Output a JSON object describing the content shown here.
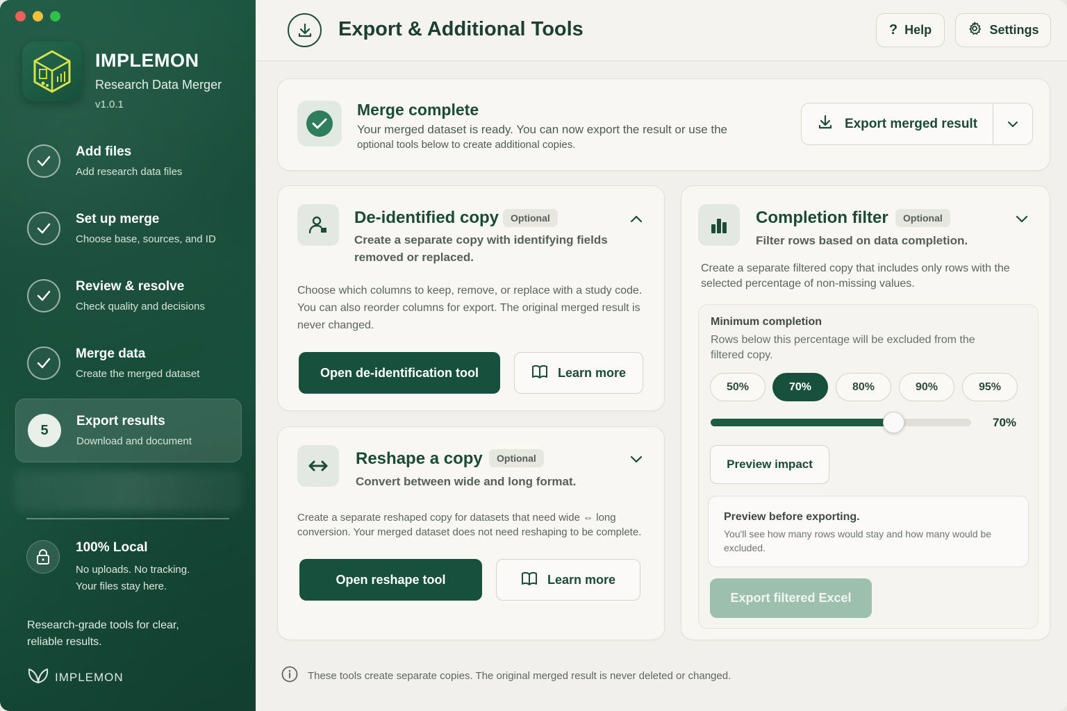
{
  "app": {
    "name": "IMPLEMON",
    "subtitle": "Research Data Merger",
    "version": "v1.0.1"
  },
  "sidebar": {
    "steps": [
      {
        "title": "Add files",
        "subtitle": "Add research data files",
        "state": "done"
      },
      {
        "title": "Set up merge",
        "subtitle": "Choose base, sources, and ID",
        "state": "done"
      },
      {
        "title": "Review & resolve",
        "subtitle": "Check quality and decisions",
        "state": "done"
      },
      {
        "title": "Merge data",
        "subtitle": "Create the merged dataset",
        "state": "done"
      },
      {
        "title": "Export results",
        "subtitle": "Download and document",
        "state": "active",
        "number": "5"
      }
    ],
    "local": {
      "title": "100% Local",
      "subtitle": "No uploads. No tracking. Your files stay here."
    },
    "tagline": "Research-grade tools for clear, reliable results.",
    "footer_brand": "IMPLEMON"
  },
  "header": {
    "title": "Export & Additional Tools",
    "help_label": "Help",
    "settings_label": "Settings"
  },
  "merge": {
    "title": "Merge complete",
    "description": "Your merged dataset is ready. You can now export the result or use the",
    "description_small": "optional tools below to create additional copies.",
    "export_label": "Export merged result"
  },
  "deid": {
    "title": "De-identified copy",
    "badge": "Optional",
    "subtitle": "Create a separate copy with identifying fields removed or replaced.",
    "description": "Choose which columns to keep, remove, or replace with a study code. You can also reorder columns for export. The original merged result is never changed.",
    "primary_label": "Open de-identification tool",
    "learn_label": "Learn more"
  },
  "reshape": {
    "title": "Reshape a copy",
    "badge": "Optional",
    "subtitle": "Convert between wide and long format.",
    "description": "Create a separate reshaped copy for datasets that need wide ⇔ long conversion. Your merged dataset does not need reshaping to be complete.",
    "primary_label": "Open reshape tool",
    "learn_label": "Learn more"
  },
  "filter": {
    "title": "Completion filter",
    "badge": "Optional",
    "subtitle": "Filter rows based on data completion.",
    "description": "Create a separate filtered copy that includes only rows with the selected percentage of non-missing values.",
    "min_title": "Minimum completion",
    "min_desc": "Rows below this percentage will be excluded from the filtered copy.",
    "options": [
      "50%",
      "70%",
      "80%",
      "90%",
      "95%"
    ],
    "selected": "70%",
    "slider_value": 70,
    "slider_label": "70%",
    "preview_label": "Preview impact",
    "preview_title": "Preview before exporting.",
    "preview_desc": "You'll see how many rows would stay and how many would be excluded.",
    "export_label": "Export filtered Excel"
  },
  "footnote": "These tools create separate copies. The original merged result is never deleted or changed.",
  "colors": {
    "sidebar": "#17503d",
    "primary": "#17503d",
    "accent_check": "#2f7d5c",
    "disabled_button": "#9cbfae"
  }
}
